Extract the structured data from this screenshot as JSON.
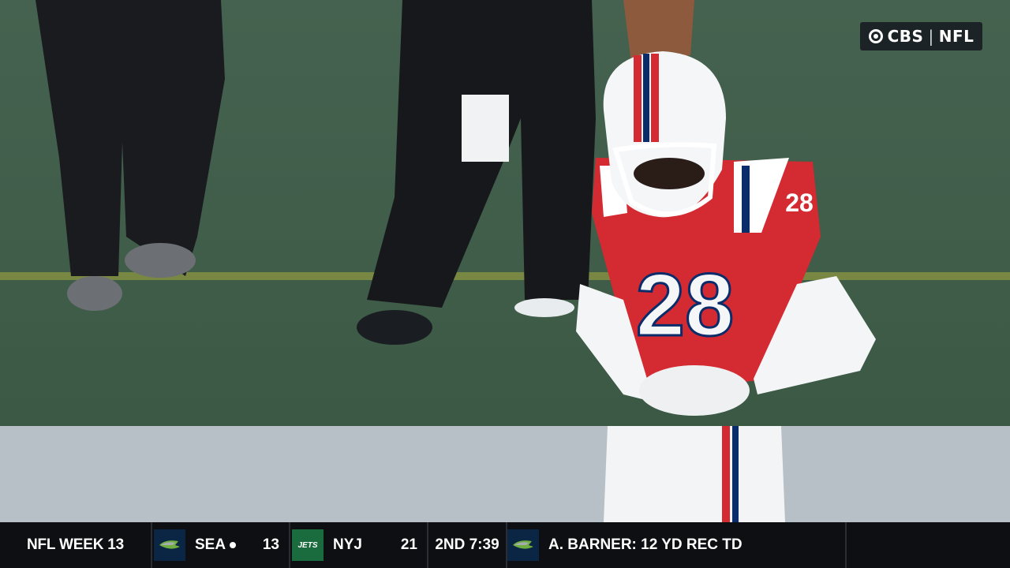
{
  "broadcast_bug": {
    "network": "CBS",
    "separator": "|",
    "league": "NFL"
  },
  "ticker": {
    "week_label": "NFL WEEK 13",
    "away": {
      "abbr": "SEA",
      "score": "13",
      "possession": true,
      "logo": "seahawks-logo-icon"
    },
    "home": {
      "abbr": "NYJ",
      "score": "21",
      "logo": "jets-logo-icon",
      "logo_text": "JETS"
    },
    "game_clock": "2ND 7:39",
    "last_play": {
      "team_logo": "seahawks-logo-icon",
      "text": "A. BARNER: 12 YD REC TD"
    }
  },
  "scene": {
    "player_number": "28"
  },
  "colors": {
    "field": "#3d5a48",
    "jersey": "#d42a32",
    "ticker_bg": "#0d0f12",
    "seahawks": "#0b2545",
    "jets": "#1a6b3d"
  }
}
